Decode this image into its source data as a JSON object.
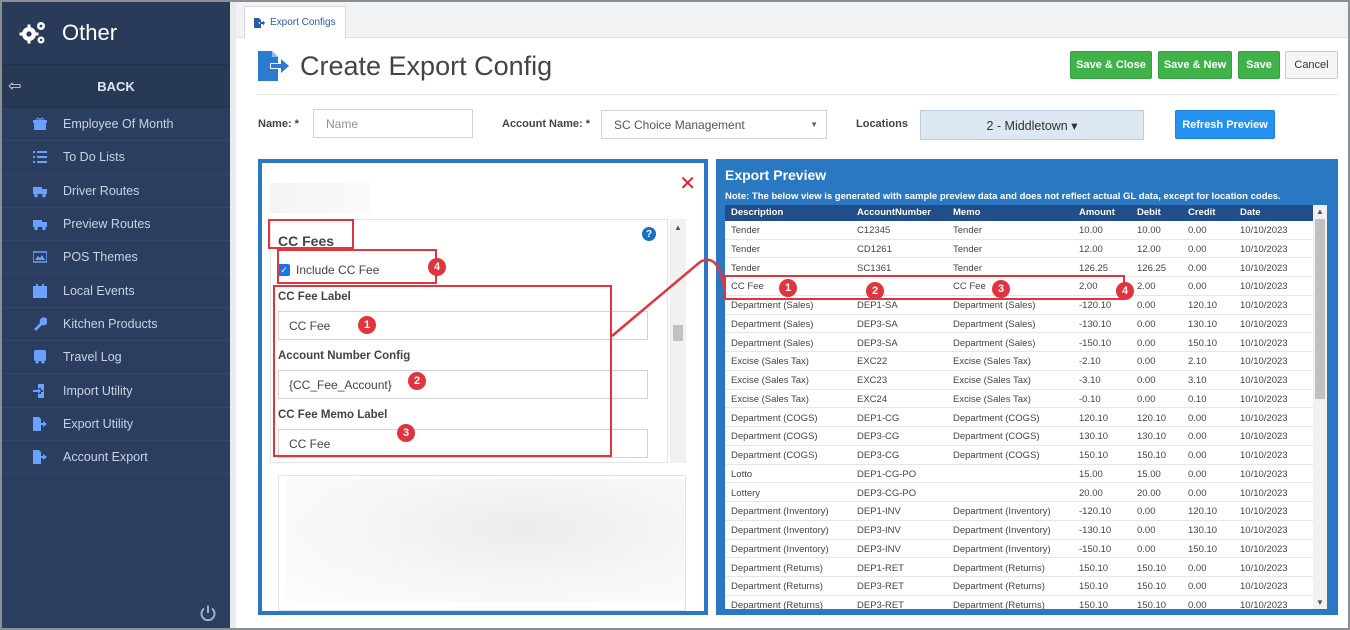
{
  "sidebar": {
    "title": "Other",
    "back_label": "BACK",
    "items": [
      {
        "label": "Employee Of Month",
        "icon": "gift-icon"
      },
      {
        "label": "To Do Lists",
        "icon": "list-icon"
      },
      {
        "label": "Driver Routes",
        "icon": "truck-icon"
      },
      {
        "label": "Preview Routes",
        "icon": "truck-icon"
      },
      {
        "label": "POS Themes",
        "icon": "image-icon"
      },
      {
        "label": "Local Events",
        "icon": "calendar-icon"
      },
      {
        "label": "Kitchen Products",
        "icon": "wrench-icon"
      },
      {
        "label": "Travel Log",
        "icon": "bus-icon"
      },
      {
        "label": "Import Utility",
        "icon": "import-icon"
      },
      {
        "label": "Export Utility",
        "icon": "export-icon"
      },
      {
        "label": "Account Export",
        "icon": "export-icon"
      }
    ]
  },
  "tab": {
    "label": "Export Configs"
  },
  "page": {
    "title": "Create Export Config"
  },
  "toolbar": {
    "save_close": "Save & Close",
    "save_new": "Save & New",
    "save": "Save",
    "cancel": "Cancel",
    "refresh_preview": "Refresh Preview"
  },
  "form": {
    "name_label": "Name: *",
    "name_placeholder": "Name",
    "account_label": "Account Name: *",
    "account_value": "SC Choice Management",
    "locations_label": "Locations",
    "locations_value": "2 - Middletown ▾"
  },
  "cc_panel": {
    "section_title": "CC Fees",
    "include_label": "Include CC Fee",
    "include_checked": true,
    "fee_label_label": "CC Fee Label",
    "fee_label_value": "CC Fee",
    "account_number_label": "Account Number Config",
    "account_number_value": "{CC_Fee_Account}",
    "memo_label_label": "CC Fee Memo Label",
    "memo_label_value": "CC Fee",
    "help": "?"
  },
  "badges": {
    "one": "1",
    "two": "2",
    "three": "3",
    "four": "4"
  },
  "preview": {
    "title": "Export Preview",
    "note": "Note: The below view is generated with sample preview data and does not reflect actual GL data, except for location codes.",
    "columns": [
      "Description",
      "AccountNumber",
      "Memo",
      "Amount",
      "Debit",
      "Credit",
      "Date"
    ],
    "rows": [
      [
        "Tender",
        "C12345",
        "Tender",
        "10.00",
        "10.00",
        "0.00",
        "10/10/2023"
      ],
      [
        "Tender",
        "CD1261",
        "Tender",
        "12.00",
        "12.00",
        "0.00",
        "10/10/2023"
      ],
      [
        "Tender",
        "SC1361",
        "Tender",
        "126.25",
        "126.25",
        "0.00",
        "10/10/2023"
      ],
      [
        "CC Fee",
        "",
        "CC Fee",
        "2.00",
        "2.00",
        "0.00",
        "10/10/2023"
      ],
      [
        "Department (Sales)",
        "DEP1-SA",
        "Department (Sales)",
        "-120.10",
        "0.00",
        "120.10",
        "10/10/2023"
      ],
      [
        "Department (Sales)",
        "DEP3-SA",
        "Department (Sales)",
        "-130.10",
        "0.00",
        "130.10",
        "10/10/2023"
      ],
      [
        "Department (Sales)",
        "DEP3-SA",
        "Department (Sales)",
        "-150.10",
        "0.00",
        "150.10",
        "10/10/2023"
      ],
      [
        "Excise (Sales Tax)",
        "EXC22",
        "Excise (Sales Tax)",
        "-2.10",
        "0.00",
        "2.10",
        "10/10/2023"
      ],
      [
        "Excise (Sales Tax)",
        "EXC23",
        "Excise (Sales Tax)",
        "-3.10",
        "0.00",
        "3.10",
        "10/10/2023"
      ],
      [
        "Excise (Sales Tax)",
        "EXC24",
        "Excise (Sales Tax)",
        "-0.10",
        "0.00",
        "0.10",
        "10/10/2023"
      ],
      [
        "Department (COGS)",
        "DEP1-CG",
        "Department (COGS)",
        "120.10",
        "120.10",
        "0.00",
        "10/10/2023"
      ],
      [
        "Department (COGS)",
        "DEP3-CG",
        "Department (COGS)",
        "130.10",
        "130.10",
        "0.00",
        "10/10/2023"
      ],
      [
        "Department (COGS)",
        "DEP3-CG",
        "Department (COGS)",
        "150.10",
        "150.10",
        "0.00",
        "10/10/2023"
      ],
      [
        "Lotto",
        "DEP1-CG-PO",
        "",
        "15.00",
        "15.00",
        "0.00",
        "10/10/2023"
      ],
      [
        "Lottery",
        "DEP3-CG-PO",
        "",
        "20.00",
        "20.00",
        "0.00",
        "10/10/2023"
      ],
      [
        "Department (Inventory)",
        "DEP1-INV",
        "Department (Inventory)",
        "-120.10",
        "0.00",
        "120.10",
        "10/10/2023"
      ],
      [
        "Department (Inventory)",
        "DEP3-INV",
        "Department (Inventory)",
        "-130.10",
        "0.00",
        "130.10",
        "10/10/2023"
      ],
      [
        "Department (Inventory)",
        "DEP3-INV",
        "Department (Inventory)",
        "-150.10",
        "0.00",
        "150.10",
        "10/10/2023"
      ],
      [
        "Department (Returns)",
        "DEP1-RET",
        "Department (Returns)",
        "150.10",
        "150.10",
        "0.00",
        "10/10/2023"
      ],
      [
        "Department (Returns)",
        "DEP3-RET",
        "Department (Returns)",
        "150.10",
        "150.10",
        "0.00",
        "10/10/2023"
      ],
      [
        "Department (Returns)",
        "DEP3-RET",
        "Department (Returns)",
        "150.10",
        "150.10",
        "0.00",
        "10/10/2023"
      ]
    ]
  },
  "colors": {
    "sidebar_bg": "#2c3e5f",
    "panel_blue": "#2b78c2",
    "annotation_red": "#e0353e",
    "save_green": "#3fb24a",
    "refresh_blue": "#2591f0"
  }
}
